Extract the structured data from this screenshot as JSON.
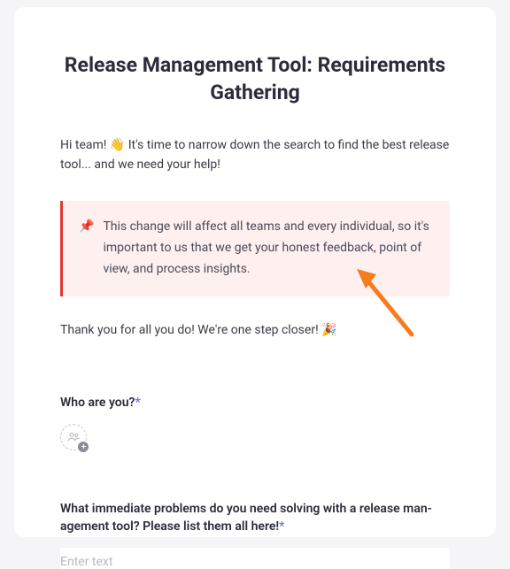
{
  "title": "Release Management Tool: Requirements Gathering",
  "intro_prefix": "Hi team! ",
  "intro_emoji": "👋",
  "intro_suffix": " It's time to narrow down the search to find the best release tool... and we need your help!",
  "callout": {
    "icon": "📌",
    "text": "This change will affect all teams and every individual, so it's important to us that we get your honest feedback, point of view, and process insights."
  },
  "thanks_prefix": "Thank you for all you do! We're one step closer! ",
  "thanks_emoji": "🎉",
  "questions": {
    "who": {
      "label": "Who are you?",
      "required_mark": "*"
    },
    "problems": {
      "label": "What immediate problems do you need solving with a release man-agement tool? Please list them all here!",
      "required_mark": "*",
      "placeholder": "Enter text"
    }
  }
}
